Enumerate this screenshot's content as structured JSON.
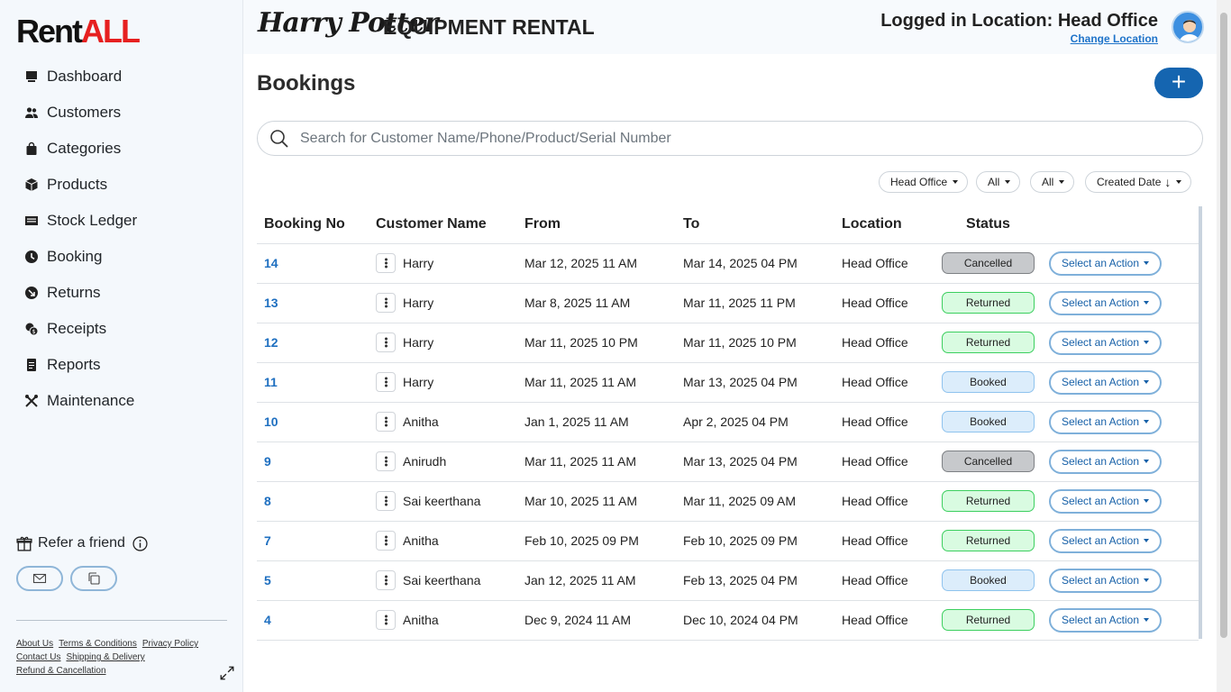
{
  "brand": {
    "name_part1": "Rent",
    "name_part2": "ALL"
  },
  "sidebar": {
    "items": [
      {
        "label": "Dashboard",
        "icon": "monitor-icon"
      },
      {
        "label": "Customers",
        "icon": "users-icon"
      },
      {
        "label": "Categories",
        "icon": "bag-icon"
      },
      {
        "label": "Products",
        "icon": "box-icon"
      },
      {
        "label": "Stock Ledger",
        "icon": "ledger-icon"
      },
      {
        "label": "Booking",
        "icon": "clock-icon"
      },
      {
        "label": "Returns",
        "icon": "return-arrow-icon"
      },
      {
        "label": "Receipts",
        "icon": "coins-icon"
      },
      {
        "label": "Reports",
        "icon": "report-icon"
      },
      {
        "label": "Maintenance",
        "icon": "tools-icon"
      }
    ],
    "refer_label": "Refer a friend",
    "footer": {
      "about": "About Us",
      "terms": "Terms & Conditions",
      "privacy": "Privacy Policy",
      "contact": "Contact Us",
      "shipping": "Shipping & Delivery",
      "refund": "Refund & Cancellation"
    }
  },
  "header": {
    "logo_text": "Harry Potter",
    "title": "EQUIPMENT RENTAL",
    "location_prefix": "Logged in Location: ",
    "location": "Head Office",
    "change_location": "Change Location"
  },
  "main": {
    "page_title": "Bookings",
    "add_label": "+",
    "search_placeholder": "Search for Customer Name/Phone/Product/Serial Number",
    "filters": {
      "location": "Head Office",
      "filter2": "All",
      "filter3": "All",
      "sort": "Created Date",
      "sort_arrow": "↓"
    },
    "columns": [
      "Booking No",
      "Customer Name",
      "From",
      "To",
      "Location",
      "Status"
    ],
    "action_label": "Select an Action",
    "rows": [
      {
        "no": "14",
        "customer": "Harry",
        "from": "Mar 12, 2025 11 AM",
        "to": "Mar 14, 2025 04 PM",
        "location": "Head Office",
        "status": "Cancelled"
      },
      {
        "no": "13",
        "customer": "Harry",
        "from": "Mar 8, 2025 11 AM",
        "to": "Mar 11, 2025 11 PM",
        "location": "Head Office",
        "status": "Returned"
      },
      {
        "no": "12",
        "customer": "Harry",
        "from": "Mar 11, 2025 10 PM",
        "to": "Mar 11, 2025 10 PM",
        "location": "Head Office",
        "status": "Returned"
      },
      {
        "no": "11",
        "customer": "Harry",
        "from": "Mar 11, 2025 11 AM",
        "to": "Mar 13, 2025 04 PM",
        "location": "Head Office",
        "status": "Booked"
      },
      {
        "no": "10",
        "customer": "Anitha",
        "from": "Jan 1, 2025 11 AM",
        "to": "Apr 2, 2025 04 PM",
        "location": "Head Office",
        "status": "Booked"
      },
      {
        "no": "9",
        "customer": "Anirudh",
        "from": "Mar 11, 2025 11 AM",
        "to": "Mar 13, 2025 04 PM",
        "location": "Head Office",
        "status": "Cancelled"
      },
      {
        "no": "8",
        "customer": "Sai keerthana",
        "from": "Mar 10, 2025 11 AM",
        "to": "Mar 11, 2025 09 AM",
        "location": "Head Office",
        "status": "Returned"
      },
      {
        "no": "7",
        "customer": "Anitha",
        "from": "Feb 10, 2025 09 PM",
        "to": "Feb 10, 2025 09 PM",
        "location": "Head Office",
        "status": "Returned"
      },
      {
        "no": "5",
        "customer": "Sai keerthana",
        "from": "Jan 12, 2025 11 AM",
        "to": "Feb 13, 2025 04 PM",
        "location": "Head Office",
        "status": "Booked"
      },
      {
        "no": "4",
        "customer": "Anitha",
        "from": "Dec 9, 2024 11 AM",
        "to": "Dec 10, 2024 04 PM",
        "location": "Head Office",
        "status": "Returned"
      }
    ]
  },
  "colors": {
    "accent": "#1565b0",
    "link": "#1e6fc0",
    "brand_red": "#e62020"
  }
}
